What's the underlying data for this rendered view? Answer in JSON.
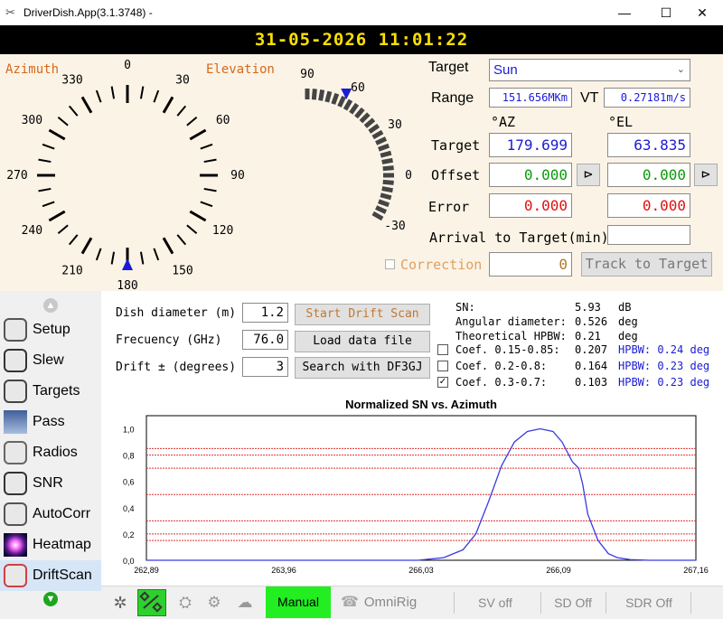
{
  "window": {
    "title": "DriverDish.App(3.1.3748) -"
  },
  "clock": "31-05-2026 11:01:22",
  "azimuth": {
    "label": "Azimuth",
    "ticks": [
      "0",
      "30",
      "60",
      "90",
      "120",
      "150",
      "180",
      "210",
      "240",
      "270",
      "300",
      "330"
    ],
    "pointer_deg": 180
  },
  "elevation": {
    "label": "Elevation",
    "ticks": [
      "90",
      "60",
      "30",
      "0",
      "-30"
    ],
    "pointer_deg": 63.835
  },
  "target": {
    "label": "Target",
    "selected": "Sun",
    "range_label": "Range",
    "range_value": "151.656MKm",
    "vt_label": "VT",
    "vt_value": "0.27181m/s",
    "az_header": "°AZ",
    "el_header": "°EL",
    "target_row_label": "Target",
    "target_az": "179.699",
    "target_el": "63.835",
    "offset_label": "Offset",
    "offset_az": "0.000",
    "offset_el": "0.000",
    "error_label": "Error",
    "error_az": "0.000",
    "error_el": "0.000",
    "arrival_label": "Arrival to Target(min)",
    "arrival_value": "",
    "correction_label": "Correction",
    "correction_value": "0",
    "track_button": "Track to Target"
  },
  "nav": {
    "items": [
      {
        "label": "Setup",
        "icon": "setup-icon"
      },
      {
        "label": "Slew",
        "icon": "gauge-icon"
      },
      {
        "label": "Targets",
        "icon": "satellite-icon"
      },
      {
        "label": "Pass",
        "icon": "pass-icon"
      },
      {
        "label": "Radios",
        "icon": "radio-operator-icon"
      },
      {
        "label": "SNR",
        "icon": "snr-meter-icon"
      },
      {
        "label": "AutoCorr",
        "icon": "dish-icon"
      },
      {
        "label": "Heatmap",
        "icon": "heatmap-icon"
      },
      {
        "label": "DriftScan",
        "icon": "driftscan-icon"
      }
    ]
  },
  "drift": {
    "dish_label": "Dish diameter (m)",
    "dish_value": "1.2",
    "freq_label": "Frecuency (GHz)",
    "freq_value": "76.0",
    "drift_label": "Drift ± (degrees)",
    "drift_value": "3",
    "start_button": "Start Drift Scan",
    "load_button": "Load data file",
    "search_button": "Search with DF3GJ",
    "sn_label": "SN:",
    "sn_value": "5.93",
    "sn_unit": "dB",
    "ang_label": "Angular diameter:",
    "ang_value": "0.526",
    "ang_unit": "deg",
    "hpbw_label": "Theoretical HPBW:",
    "hpbw_value": "0.21",
    "hpbw_unit": "deg",
    "coefs": [
      {
        "label": "Coef. 0.15-0.85:",
        "value": "0.207",
        "hpbw": "HPBW: 0.24 deg",
        "checked": false
      },
      {
        "label": "Coef. 0.2-0.8:",
        "value": "0.164",
        "hpbw": "HPBW: 0.23 deg",
        "checked": false
      },
      {
        "label": "Coef. 0.3-0.7:",
        "value": "0.103",
        "hpbw": "HPBW: 0.23 deg",
        "checked": true
      }
    ]
  },
  "bottom": {
    "manual": "Manual",
    "omnirig": "OmniRig",
    "sv": "SV off",
    "sd": "SD Off",
    "sdr": "SDR Off"
  },
  "chart_data": {
    "type": "line",
    "title": "Normalized SN vs. Azimuth",
    "xlabel": "",
    "ylabel": "",
    "x_ticks": [
      "262,89",
      "263,96",
      "266,03",
      "266,09",
      "267,16"
    ],
    "y_ticks": [
      "0,0",
      "0,2",
      "0,4",
      "0,6",
      "0,8",
      "1,0"
    ],
    "xlim": [
      262.89,
      267.16
    ],
    "ylim": [
      0,
      1.1
    ],
    "reference_lines_y": [
      0.15,
      0.2,
      0.3,
      0.5,
      0.7,
      0.8,
      0.85
    ],
    "series": [
      {
        "color": "#3a3ae0",
        "x": [
          262.89,
          264.5,
          265.0,
          265.2,
          265.35,
          265.45,
          265.55,
          265.65,
          265.75,
          265.85,
          265.95,
          266.05,
          266.12,
          266.2,
          266.25,
          266.28,
          266.32,
          266.4,
          266.48,
          266.55,
          266.65,
          266.8,
          267.0,
          267.16
        ],
        "y": [
          0.0,
          0.0,
          0.0,
          0.02,
          0.08,
          0.2,
          0.45,
          0.72,
          0.9,
          0.98,
          1.0,
          0.98,
          0.9,
          0.75,
          0.7,
          0.58,
          0.35,
          0.15,
          0.05,
          0.02,
          0.005,
          0.0,
          0.0,
          0.0
        ]
      }
    ],
    "grid": false
  }
}
